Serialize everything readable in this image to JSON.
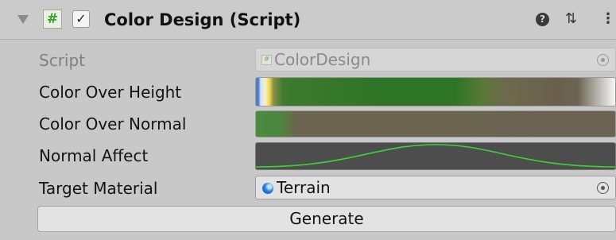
{
  "header": {
    "title": "Color Design (Script)",
    "enabled": true,
    "script_icon_glyph": "#",
    "toggle_glyph": "✓",
    "help_glyph": "?",
    "presets_glyph": "⇅",
    "menu_glyph": "⋮"
  },
  "fields": {
    "script": {
      "label": "Script",
      "value": "ColorDesign",
      "icon": "script-file-icon"
    },
    "color_over_height": {
      "label": "Color Over Height",
      "colors": [
        "#3e7bdc",
        "#f3f2c9",
        "#f0d64a",
        "#2e7427",
        "#6a604d",
        "#f6f6f6"
      ]
    },
    "color_over_normal": {
      "label": "Color Over Normal",
      "colors": [
        "#4c8a41",
        "#6b6352"
      ]
    },
    "normal_affect": {
      "label": "Normal Affect",
      "curve_color": "#3bd33b",
      "background": "#4d4d4d"
    },
    "target_material": {
      "label": "Target Material",
      "value": "Terrain",
      "icon": "material-sphere-icon"
    }
  },
  "generate_label": "Generate",
  "colors": {
    "panel_bg": "#c8c8c8",
    "script_icon_green": "#3ba02d"
  }
}
